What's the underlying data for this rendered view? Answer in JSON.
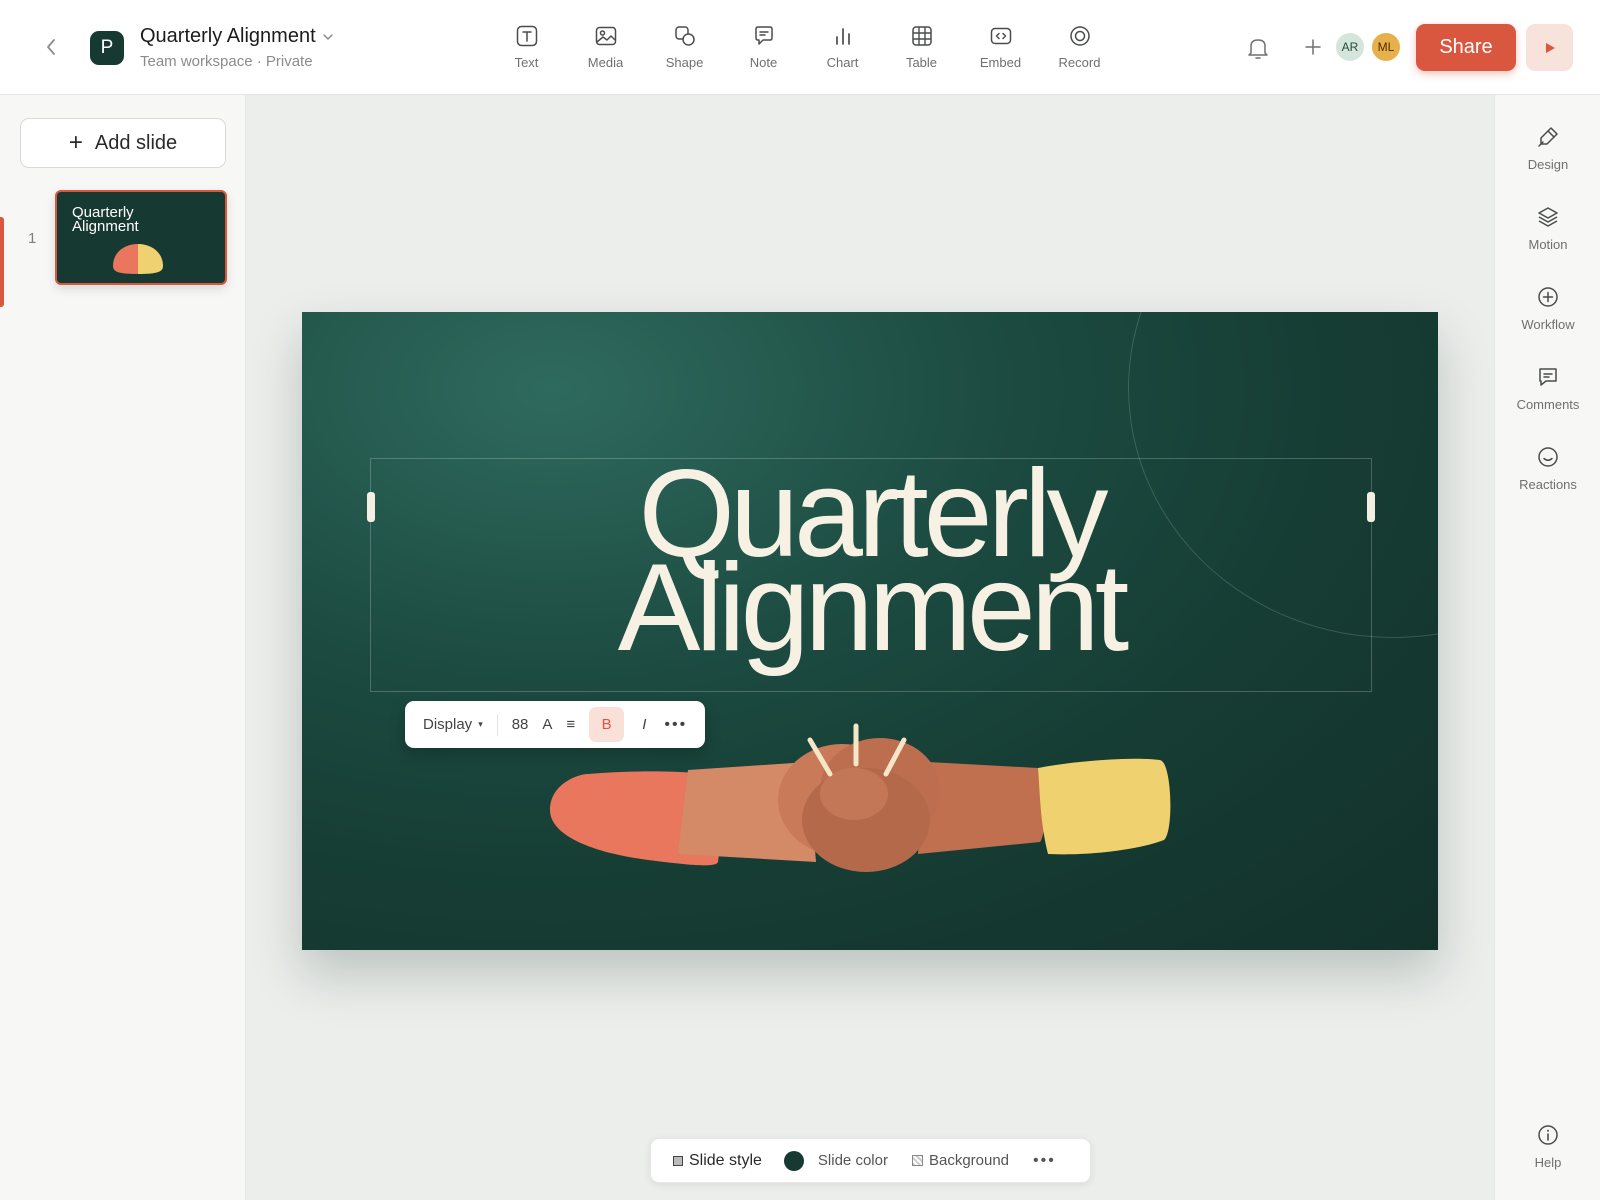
{
  "header": {
    "logo_letter": "P",
    "title": "Quarterly Alignment",
    "subtitle": "Team workspace · Private",
    "tools": [
      {
        "label": "Text",
        "icon": "text-icon"
      },
      {
        "label": "Media",
        "icon": "image-icon"
      },
      {
        "label": "Shape",
        "icon": "shape-icon"
      },
      {
        "label": "Note",
        "icon": "note-icon"
      },
      {
        "label": "Chart",
        "icon": "chart-icon"
      },
      {
        "label": "Table",
        "icon": "table-icon"
      },
      {
        "label": "Embed",
        "icon": "embed-icon"
      },
      {
        "label": "Record",
        "icon": "record-icon"
      }
    ],
    "avatars": [
      "AR",
      "ML"
    ],
    "share_label": "Share"
  },
  "left_panel": {
    "add_slide_label": "Add slide",
    "slides": [
      {
        "number": "1",
        "title": "Quarterly Alignment"
      }
    ]
  },
  "slide": {
    "title": "Quarterly\nAlignment",
    "toolbar": {
      "style_label": "Display",
      "font_size": "88",
      "text_color_label": "A",
      "align_label": "≡",
      "bold_label": "B",
      "italic_label": "I",
      "more_label": "•••"
    }
  },
  "right_panel": {
    "items": [
      {
        "label": "Design",
        "icon": "design-icon"
      },
      {
        "label": "Motion",
        "icon": "layers-icon"
      },
      {
        "label": "Workflow",
        "icon": "plus-circle-icon"
      },
      {
        "label": "Comments",
        "icon": "comment-icon"
      },
      {
        "label": "Reactions",
        "icon": "smile-icon"
      }
    ],
    "help_label": "Help"
  },
  "bottom_bar": {
    "slide_style_label": "Slide style",
    "slide_color_label": "Slide color",
    "background_label": "Background",
    "more_label": "•••"
  },
  "colors": {
    "accent": "#d9573f",
    "slide_bg": "#163a31",
    "title_text": "#f7f1e4",
    "hand_coral": "#e8775d",
    "hand_tan": "#d48a66",
    "hand_brown": "#c0704f",
    "hand_yellow": "#efd170"
  }
}
